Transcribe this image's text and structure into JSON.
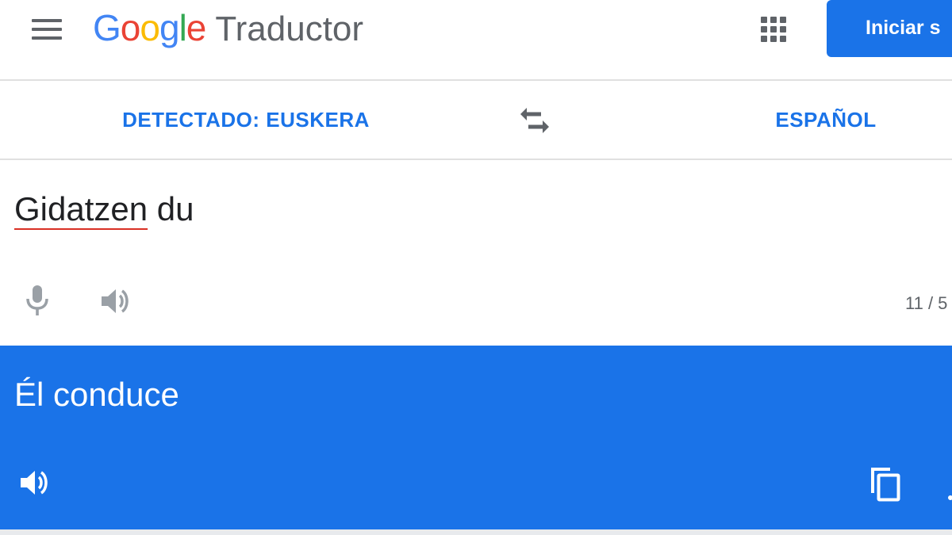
{
  "header": {
    "logo_google": [
      "G",
      "o",
      "o",
      "g",
      "l",
      "e"
    ],
    "logo_google_colors": [
      "#4285f4",
      "#ea4335",
      "#fbbc05",
      "#4285f4",
      "#34a853",
      "#ea4335"
    ],
    "product_name": "Traductor",
    "signin_label": "Iniciar s",
    "menu_icon": "hamburger-menu-icon",
    "apps_icon": "apps-grid-icon"
  },
  "language_bar": {
    "source_language": "DETECTADO: EUSKERA",
    "target_language": "ESPAÑOL",
    "swap_icon": "swap-languages-icon"
  },
  "source": {
    "text_misspelled": "Gidatzen",
    "text_rest": " du",
    "char_count": "11 / 5",
    "mic_icon": "microphone-icon",
    "speaker_icon": "speaker-icon"
  },
  "result": {
    "text": "Él conduce",
    "speaker_icon": "speaker-icon",
    "copy_icon": "copy-icon"
  },
  "colors": {
    "accent": "#1a73e8",
    "icon_gray": "#5f6368",
    "icon_light": "#9aa0a6",
    "spell_underline": "#d93025"
  }
}
